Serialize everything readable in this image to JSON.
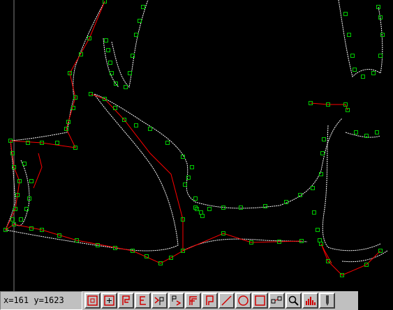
{
  "status": {
    "coordinates": "x=161 y=1623"
  },
  "colors": {
    "background": "#000000",
    "curve": "#ffffff",
    "control_line": "#ff0000",
    "node": "#00cc00",
    "toolbar": "#c0c0c0"
  },
  "toolbar": {
    "tools": [
      {
        "name": "rect-select-icon"
      },
      {
        "name": "rect-plus-icon"
      },
      {
        "name": "flag-icon"
      },
      {
        "name": "e-glyph-icon"
      },
      {
        "name": "arrow-p-icon"
      },
      {
        "name": "p-arrow-icon"
      },
      {
        "name": "f-glyph-icon"
      },
      {
        "name": "page-icon"
      },
      {
        "name": "line-tool-icon"
      },
      {
        "name": "circle-tool-icon"
      },
      {
        "name": "square-tool-icon"
      },
      {
        "name": "node-tool-icon"
      },
      {
        "name": "magnifier-icon"
      },
      {
        "name": "histogram-icon"
      },
      {
        "name": "pen-icon"
      }
    ]
  }
}
